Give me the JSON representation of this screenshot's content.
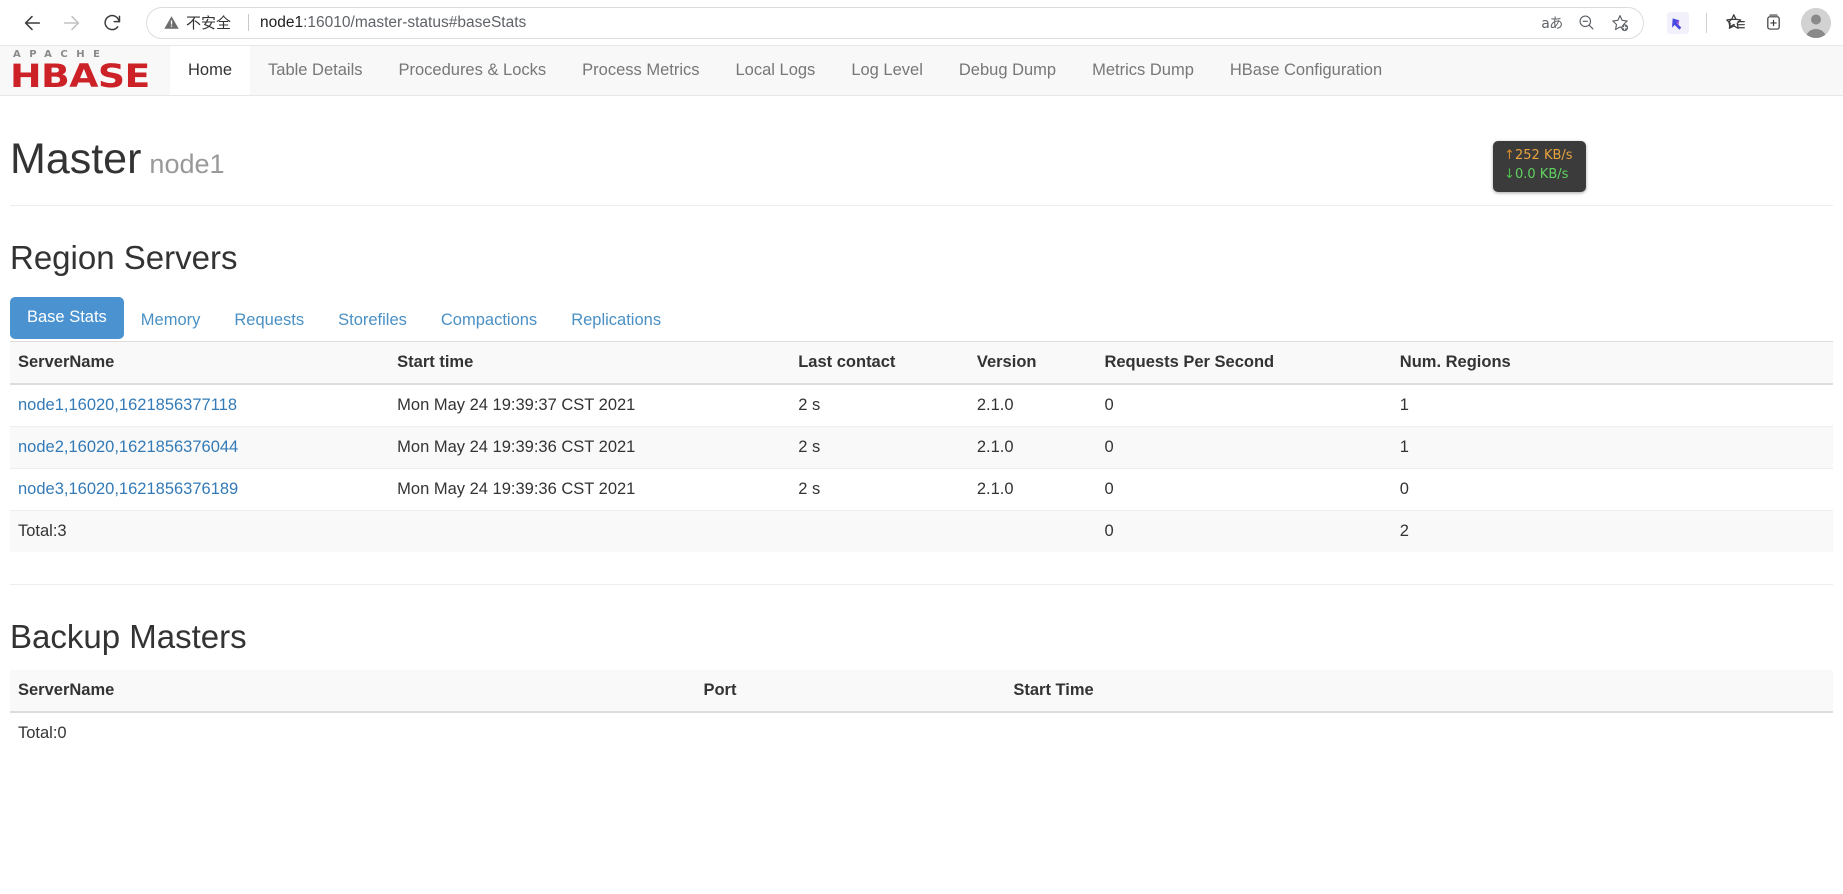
{
  "browser": {
    "back_icon": "back-arrow-icon",
    "forward_icon": "forward-arrow-icon",
    "reload_icon": "reload-icon",
    "security_label": "不安全",
    "url_host": "node1",
    "url_rest": ":16010/master-status#baseStats",
    "translate_label": "aあ",
    "icons": {
      "warning": "warning-triangle-icon",
      "translate": "translate-icon",
      "zoom_out": "zoom-out-icon",
      "add_favorite": "add-favorite-star-icon",
      "extension": "extension-icon",
      "favorites": "favorites-icon",
      "collections": "collections-icon",
      "profile": "profile-avatar-icon"
    }
  },
  "site": {
    "brand": {
      "top": "APACHE",
      "bottom": "HBASE"
    },
    "nav": [
      {
        "label": "Home",
        "active": true
      },
      {
        "label": "Table Details",
        "active": false
      },
      {
        "label": "Procedures & Locks",
        "active": false
      },
      {
        "label": "Process Metrics",
        "active": false
      },
      {
        "label": "Local Logs",
        "active": false
      },
      {
        "label": "Log Level",
        "active": false
      },
      {
        "label": "Debug Dump",
        "active": false
      },
      {
        "label": "Metrics Dump",
        "active": false
      },
      {
        "label": "HBase Configuration",
        "active": false
      }
    ]
  },
  "master": {
    "title": "Master",
    "host": "node1"
  },
  "region_servers": {
    "title": "Region Servers",
    "tabs": [
      {
        "label": "Base Stats",
        "active": true
      },
      {
        "label": "Memory",
        "active": false
      },
      {
        "label": "Requests",
        "active": false
      },
      {
        "label": "Storefiles",
        "active": false
      },
      {
        "label": "Compactions",
        "active": false
      },
      {
        "label": "Replications",
        "active": false
      }
    ],
    "columns": [
      "ServerName",
      "Start time",
      "Last contact",
      "Version",
      "Requests Per Second",
      "Num. Regions"
    ],
    "rows": [
      {
        "server_name": "node1,16020,1621856377118",
        "start_time": "Mon May 24 19:39:37 CST 2021",
        "last_contact": "2 s",
        "version": "2.1.0",
        "requests_per_second": "0",
        "num_regions": "1"
      },
      {
        "server_name": "node2,16020,1621856376044",
        "start_time": "Mon May 24 19:39:36 CST 2021",
        "last_contact": "2 s",
        "version": "2.1.0",
        "requests_per_second": "0",
        "num_regions": "1"
      },
      {
        "server_name": "node3,16020,1621856376189",
        "start_time": "Mon May 24 19:39:36 CST 2021",
        "last_contact": "2 s",
        "version": "2.1.0",
        "requests_per_second": "0",
        "num_regions": "0"
      }
    ],
    "total": {
      "label": "Total:3",
      "start_time": "",
      "last_contact": "",
      "version": "",
      "requests_per_second": "0",
      "num_regions": "2"
    }
  },
  "backup_masters": {
    "title": "Backup Masters",
    "columns": [
      "ServerName",
      "Port",
      "Start Time"
    ],
    "rows": [],
    "total": {
      "label": "Total:0"
    }
  },
  "net_speed": {
    "upload": "252 KB/s",
    "download": "0.0 KB/s",
    "up_arrow": "↑",
    "down_arrow": "↓",
    "upload_color": "#e8a33d",
    "download_color": "#5fd35f"
  }
}
